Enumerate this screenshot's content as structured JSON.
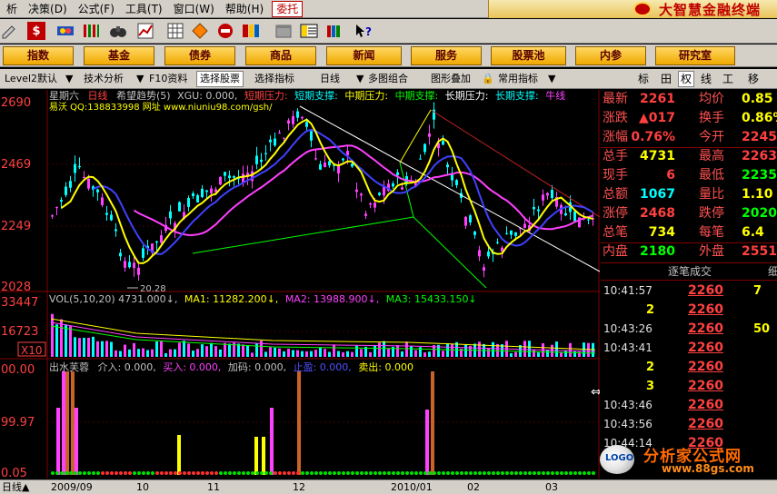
{
  "menu": {
    "items": [
      "析",
      "决策(D)",
      "公式(F)",
      "工具(T)",
      "窗口(W)",
      "帮助(H)"
    ],
    "window_tab": "委托"
  },
  "brand": {
    "title": "大智慧金融终端"
  },
  "func_buttons": [
    "指数",
    "基金",
    "债券",
    "商品",
    "新闻",
    "服务",
    "股票池",
    "内参",
    "研究室"
  ],
  "tab_bar": {
    "items": [
      "Level2默认",
      "技术分析",
      "F10资料",
      "选择股票",
      "选择指标",
      "日线",
      "多图组合",
      "图形叠加",
      "常用指标"
    ],
    "active_item": 3,
    "right_tabs": [
      "标",
      "田",
      "权",
      "线",
      "工",
      "移"
    ],
    "active_right": 2
  },
  "chart": {
    "price_title": {
      "stock": "星期六",
      "period": "日线",
      "indicator": "希望趋势(5)",
      "xgu": "XGU: 0.000,",
      "items": [
        {
          "text": "短期压力:",
          "color": "#ff4040"
        },
        {
          "text": "短期支撑:",
          "color": "#00ffff"
        },
        {
          "text": "中期压力:",
          "color": "#ffff00"
        },
        {
          "text": "中期支撑:",
          "color": "#00ff00"
        },
        {
          "text": "长期压力:",
          "color": "#ffffff"
        },
        {
          "text": "长期支撑:",
          "color": "#00ffff"
        },
        {
          "text": "牛线",
          "color": "#ff40ff"
        }
      ]
    },
    "price_subtitle": "易沃 QQ:138833998 网址 www.niuniu98.com/gsh/",
    "price_axis": [
      "2690",
      "2469",
      "2249",
      "2028"
    ],
    "low_label": "20.28",
    "vol_title": {
      "base": "VOL(5,10,20)  4731.000↓,",
      "ma1": "MA1: 11282.200↓,",
      "ma2": "MA2: 13988.900↓,",
      "ma3": "MA3: 15433.150↓"
    },
    "vol_axis": [
      "33447",
      "16723",
      "X10"
    ],
    "ind_title": {
      "name": "出水芙蓉",
      "items": [
        {
          "text": "介入: 0.000,",
          "color": "#c0c0c0"
        },
        {
          "text": "买入: 0.000,",
          "color": "#ff40ff"
        },
        {
          "text": "加码: 0.000,",
          "color": "#c0c0c0"
        },
        {
          "text": "止盈: 0.000,",
          "color": "#5050ff"
        },
        {
          "text": "卖出: 0.000",
          "color": "#ffff00"
        }
      ]
    },
    "ind_axis": [
      "00.00",
      "99.97",
      "0.05"
    ]
  },
  "quote": {
    "rows": [
      {
        "l": "最新",
        "v": "2261",
        "vc": "#ff4040",
        "l2": "均价",
        "v2": "0.85",
        "v2c": "#ffff00"
      },
      {
        "l": "涨跌",
        "v": "▲017",
        "vc": "#ff4040",
        "l2": "换手",
        "v2": "0.86%",
        "v2c": "#ffff00"
      },
      {
        "l": "涨幅",
        "v": "0.76%",
        "vc": "#ff4040",
        "l2": "今开",
        "v2": "2245",
        "v2c": "#ff4040"
      },
      {
        "l": "总手",
        "v": "4731",
        "vc": "#ffff00",
        "l2": "最高",
        "v2": "2263",
        "v2c": "#ff4040"
      },
      {
        "l": "现手",
        "v": "6",
        "vc": "#ff4040",
        "l2": "最低",
        "v2": "2235",
        "v2c": "#00ff00"
      },
      {
        "l": "总额",
        "v": "1067",
        "vc": "#00ffff",
        "l2": "量比",
        "v2": "1.10",
        "v2c": "#ffff00"
      },
      {
        "l": "涨停",
        "v": "2468",
        "vc": "#ff4040",
        "l2": "跌停",
        "v2": "2020",
        "v2c": "#00ff00"
      },
      {
        "l": "总笔",
        "v": "734",
        "vc": "#ffff00",
        "l2": "每笔",
        "v2": "6.4",
        "v2c": "#ffff00"
      },
      {
        "l": "内盘",
        "v": "2180",
        "vc": "#00ff00",
        "l2": "外盘",
        "v2": "2551",
        "v2c": "#ff4040"
      }
    ]
  },
  "tick_header": {
    "title": "逐笔成交",
    "right": "细"
  },
  "ticks": [
    {
      "time": "10:41:57",
      "price": "2260",
      "vol": "7"
    },
    {
      "time": "",
      "price": "2260",
      "vol": ""
    },
    {
      "time": "10:43:26",
      "price": "2260",
      "vol": "50"
    },
    {
      "time": "10:43:41",
      "price": "2260",
      "vol": ""
    },
    {
      "time": "",
      "price": "2260",
      "vol": ""
    },
    {
      "time": "",
      "price": "2260",
      "vol": ""
    },
    {
      "time": "10:43:46",
      "price": "2260",
      "vol": ""
    },
    {
      "time": "10:43:56",
      "price": "2260",
      "vol": ""
    },
    {
      "time": "10:44:14",
      "price": "2260",
      "vol": ""
    }
  ],
  "tick_left_vols": [
    "",
    "2",
    "",
    "",
    "2",
    "3",
    "",
    "",
    ""
  ],
  "watermark": {
    "title": "分析家公式网",
    "url": "www.88gs.com",
    "logo": "LOGO"
  },
  "datebar": {
    "range_label": "日线▲",
    "dates": [
      "2009/09",
      "10",
      "11",
      "12",
      "2010/01",
      "02",
      "03"
    ]
  },
  "colors": {
    "up": "#ff4040",
    "down": "#00ffff",
    "ma5": "#ffff00",
    "ma10": "#4040ff",
    "ma20": "#ff40ff",
    "grid_red": "#800000",
    "button_gold": "#f0a800"
  }
}
